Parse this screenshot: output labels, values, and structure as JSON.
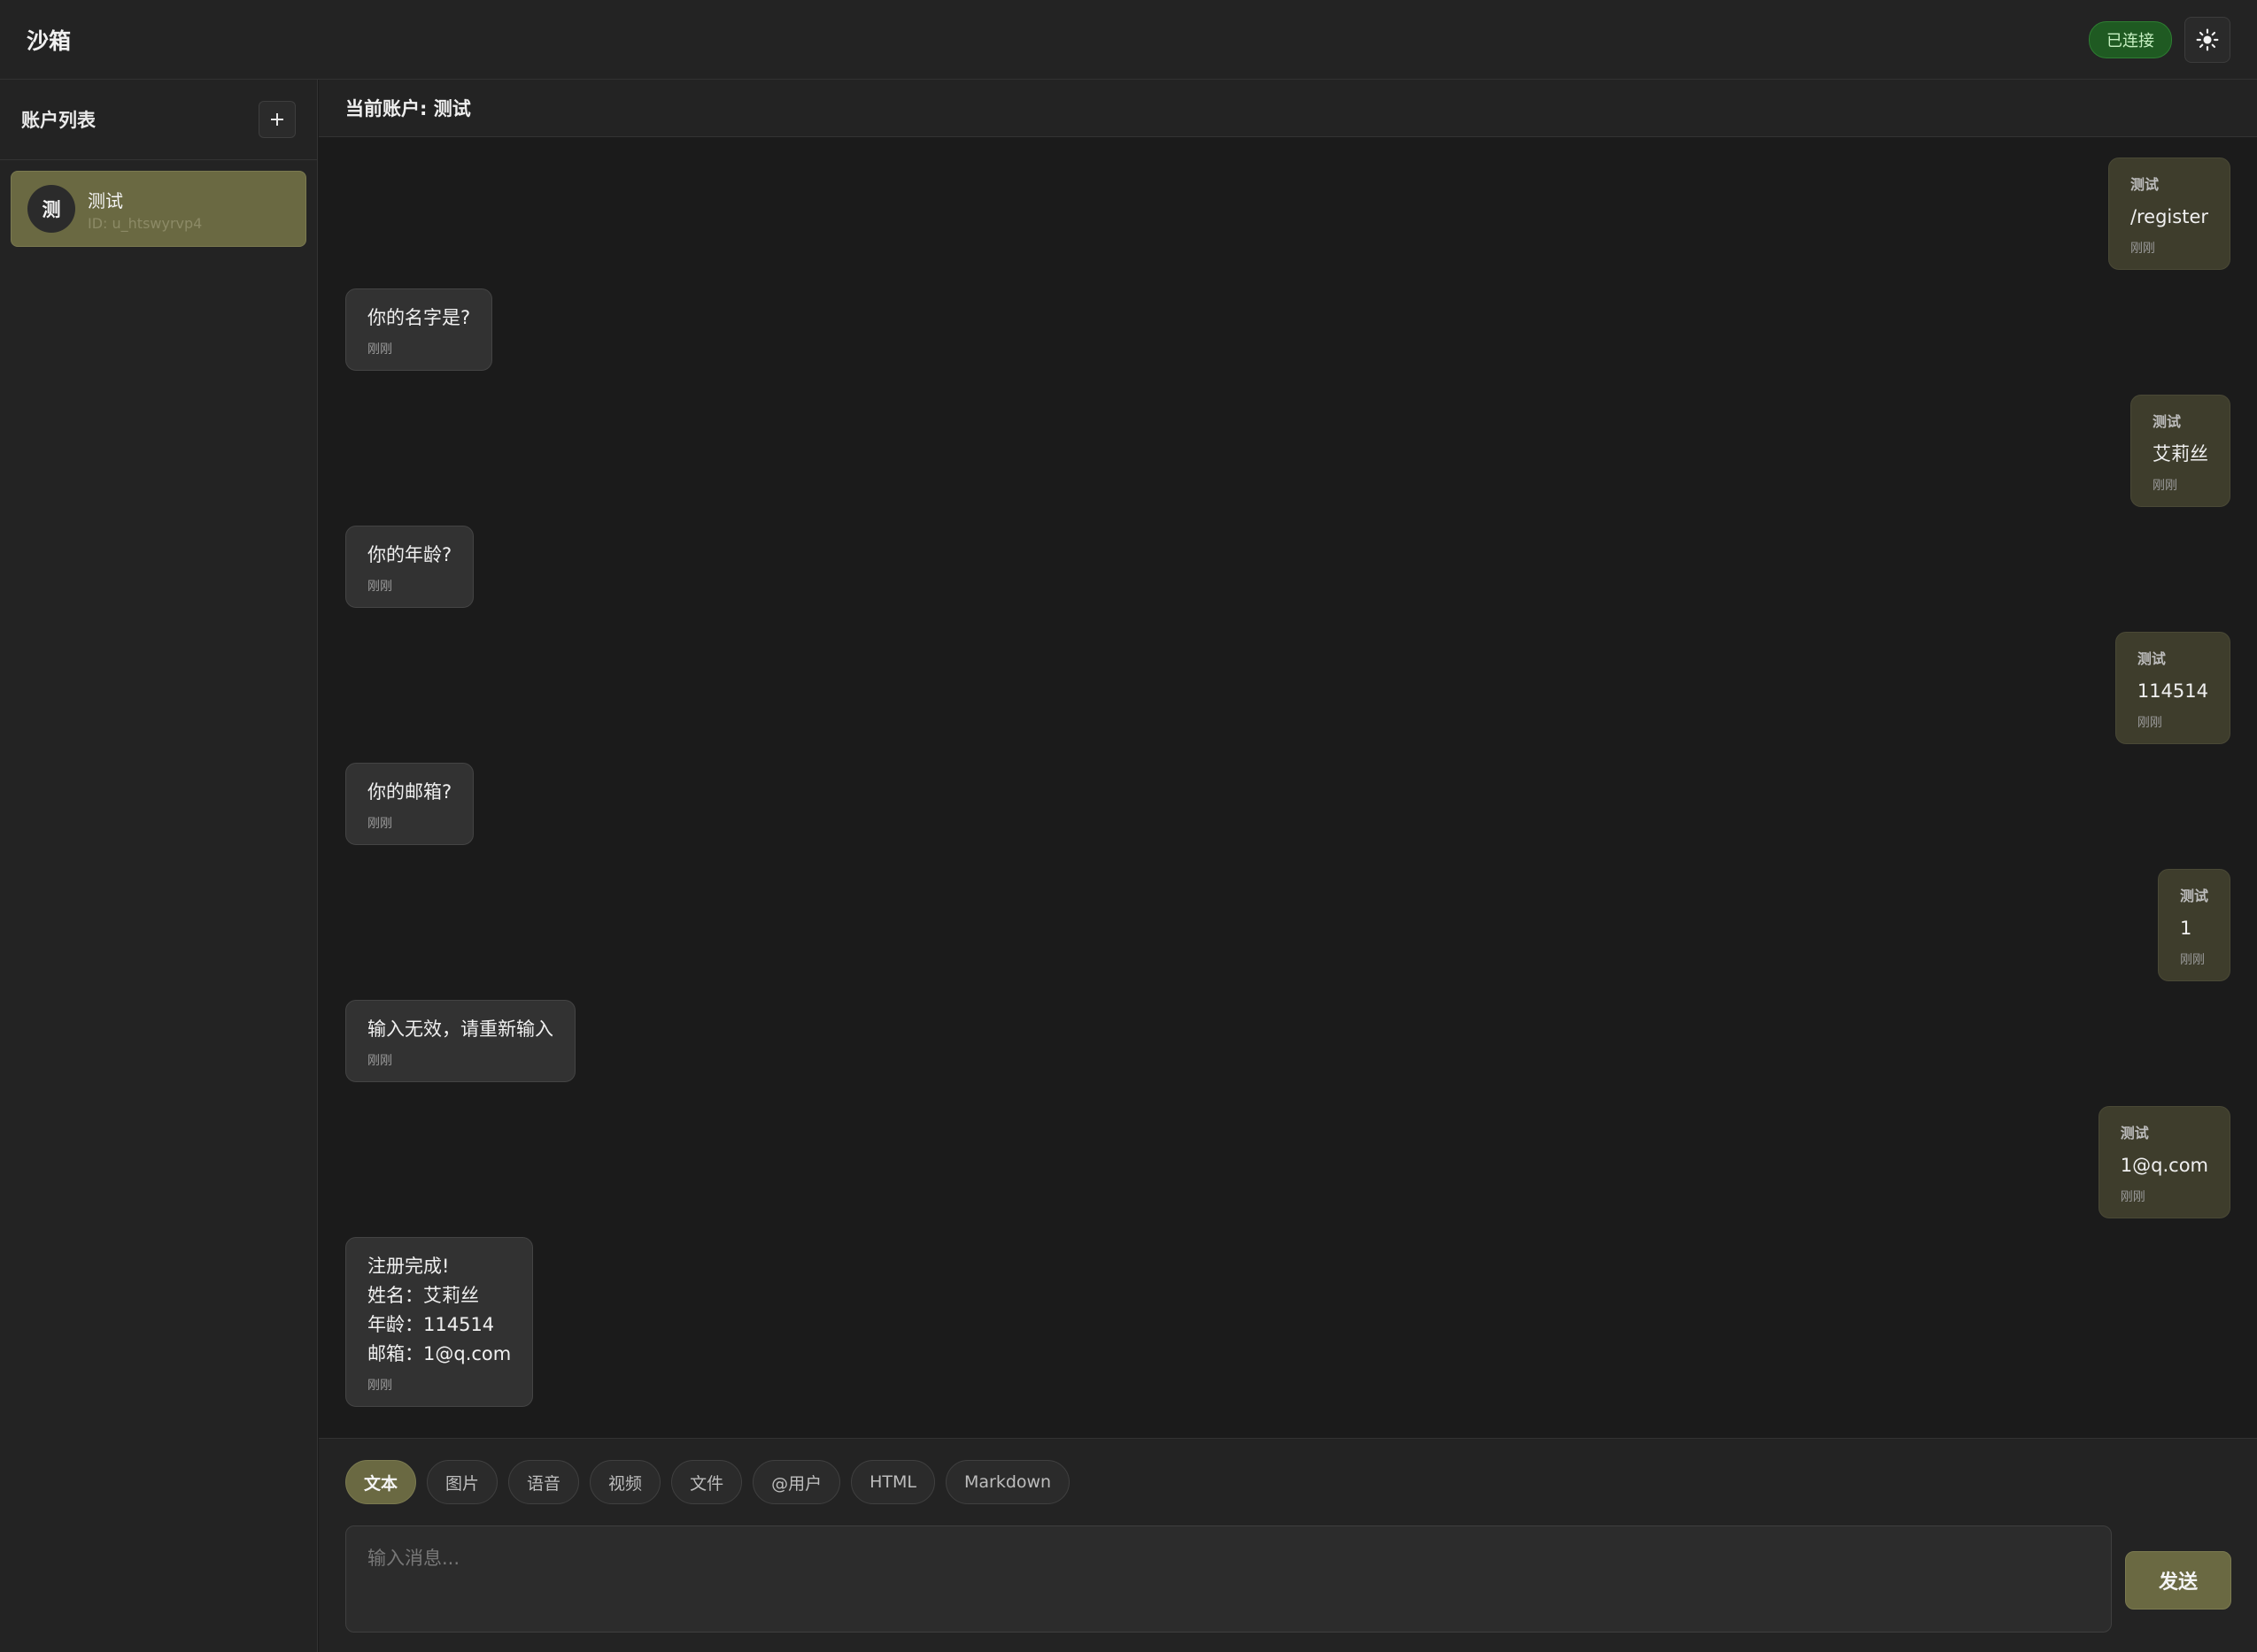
{
  "app": {
    "title": "沙箱"
  },
  "header": {
    "status": "已连接",
    "theme_icon": "sun-icon"
  },
  "sidebar": {
    "title": "账户列表",
    "add_icon": "plus-icon",
    "accounts": [
      {
        "avatar": "测",
        "name": "测试",
        "id": "ID: u_htswyrvp4"
      }
    ]
  },
  "chat": {
    "header": "当前账户: 测试",
    "messages": [
      {
        "role": "user",
        "sender": "测试",
        "text": "/register",
        "time": "刚刚"
      },
      {
        "role": "bot",
        "text": "你的名字是?",
        "time": "刚刚"
      },
      {
        "role": "user",
        "sender": "测试",
        "text": "艾莉丝",
        "time": "刚刚"
      },
      {
        "role": "bot",
        "text": "你的年龄?",
        "time": "刚刚"
      },
      {
        "role": "user",
        "sender": "测试",
        "text": "114514",
        "time": "刚刚"
      },
      {
        "role": "bot",
        "text": "你的邮箱?",
        "time": "刚刚"
      },
      {
        "role": "user",
        "sender": "测试",
        "text": "1",
        "time": "刚刚"
      },
      {
        "role": "bot",
        "text": "输入无效，请重新输入",
        "time": "刚刚"
      },
      {
        "role": "user",
        "sender": "测试",
        "text": "1@q.com",
        "time": "刚刚"
      },
      {
        "role": "bot",
        "text": "注册完成!\n姓名：艾莉丝\n年龄：114514\n邮箱：1@q.com",
        "time": "刚刚"
      }
    ]
  },
  "composer": {
    "tabs": [
      {
        "label": "文本",
        "active": true
      },
      {
        "label": "图片"
      },
      {
        "label": "语音"
      },
      {
        "label": "视频"
      },
      {
        "label": "文件"
      },
      {
        "label": "@用户"
      },
      {
        "label": "HTML"
      },
      {
        "label": "Markdown"
      }
    ],
    "placeholder": "输入消息...",
    "send_label": "发送"
  },
  "colors": {
    "accent": "#6a6942",
    "status_green": "#1f5a22",
    "background": "#1b1b1b"
  }
}
